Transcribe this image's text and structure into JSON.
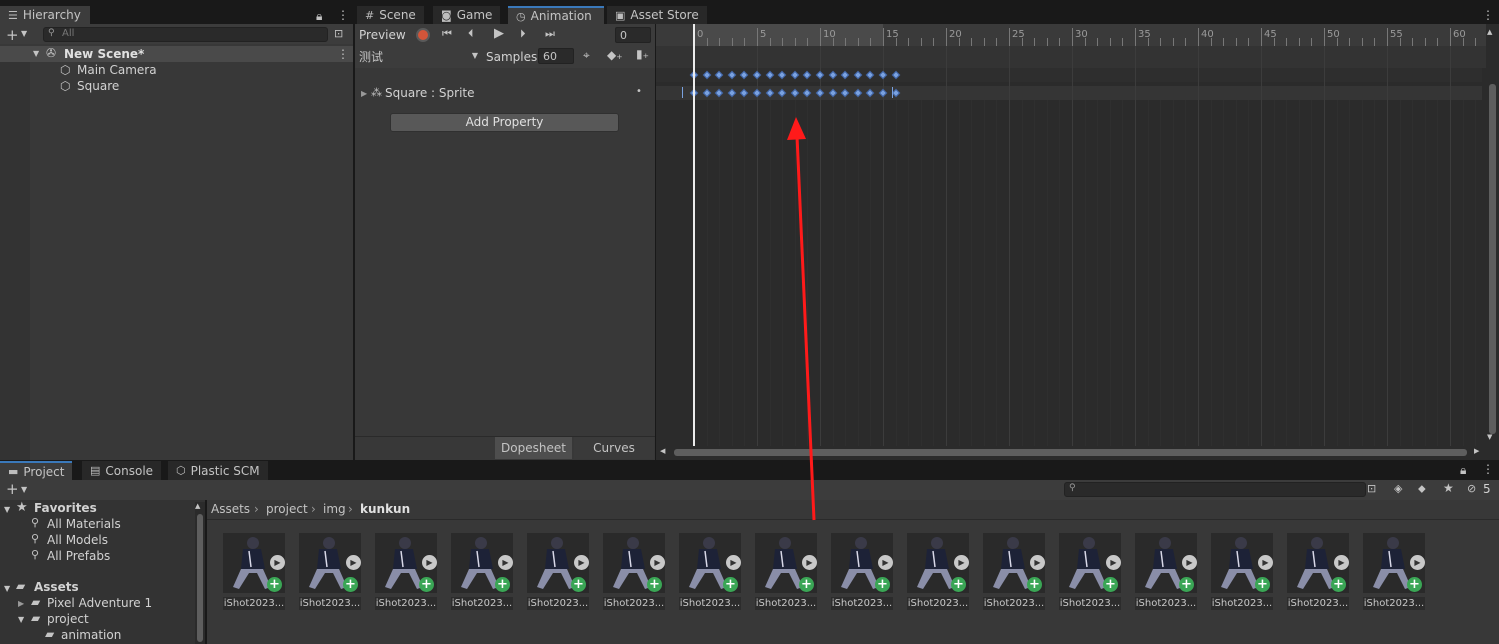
{
  "hierarchy": {
    "tab_label": "Hierarchy",
    "search_placeholder": "All",
    "scene_name": "New Scene*",
    "items": [
      {
        "label": "Main Camera"
      },
      {
        "label": "Square"
      }
    ]
  },
  "top_tabs": [
    {
      "label": "Scene"
    },
    {
      "label": "Game"
    },
    {
      "label": "Animation"
    },
    {
      "label": "Asset Store"
    }
  ],
  "animation": {
    "preview_label": "Preview",
    "frame_value": "0",
    "clip_name": "测试",
    "samples_label": "Samples",
    "samples_value": "60",
    "property_label": "Square : Sprite",
    "add_property_label": "Add Property",
    "dopesheet_label": "Dopesheet",
    "curves_label": "Curves",
    "timeline_ticks": [
      "0",
      "5",
      "10",
      "15",
      "20",
      "25",
      "30",
      "35",
      "40",
      "45",
      "50",
      "55",
      "60"
    ],
    "keyframe_count": 17,
    "keyframe_color": "#7aa2e0"
  },
  "bottom_tabs": [
    {
      "label": "Project"
    },
    {
      "label": "Console"
    },
    {
      "label": "Plastic SCM"
    }
  ],
  "project": {
    "favorites_label": "Favorites",
    "favorites": [
      {
        "label": "All Materials"
      },
      {
        "label": "All Models"
      },
      {
        "label": "All Prefabs"
      }
    ],
    "assets_label": "Assets",
    "assets": [
      {
        "label": "Pixel Adventure 1"
      },
      {
        "label": "project"
      },
      {
        "label": "animation"
      }
    ],
    "breadcrumb": [
      "Assets",
      "project",
      "img",
      "kunkun"
    ],
    "hidden_count": "5",
    "thumb_label": "iShot2023...",
    "thumb_count": 16
  },
  "colors": {
    "accent_blue": "#3a79bb",
    "record_red": "#d2553a",
    "add_green": "#3aa655",
    "arrow_red": "#ff1a1a"
  }
}
